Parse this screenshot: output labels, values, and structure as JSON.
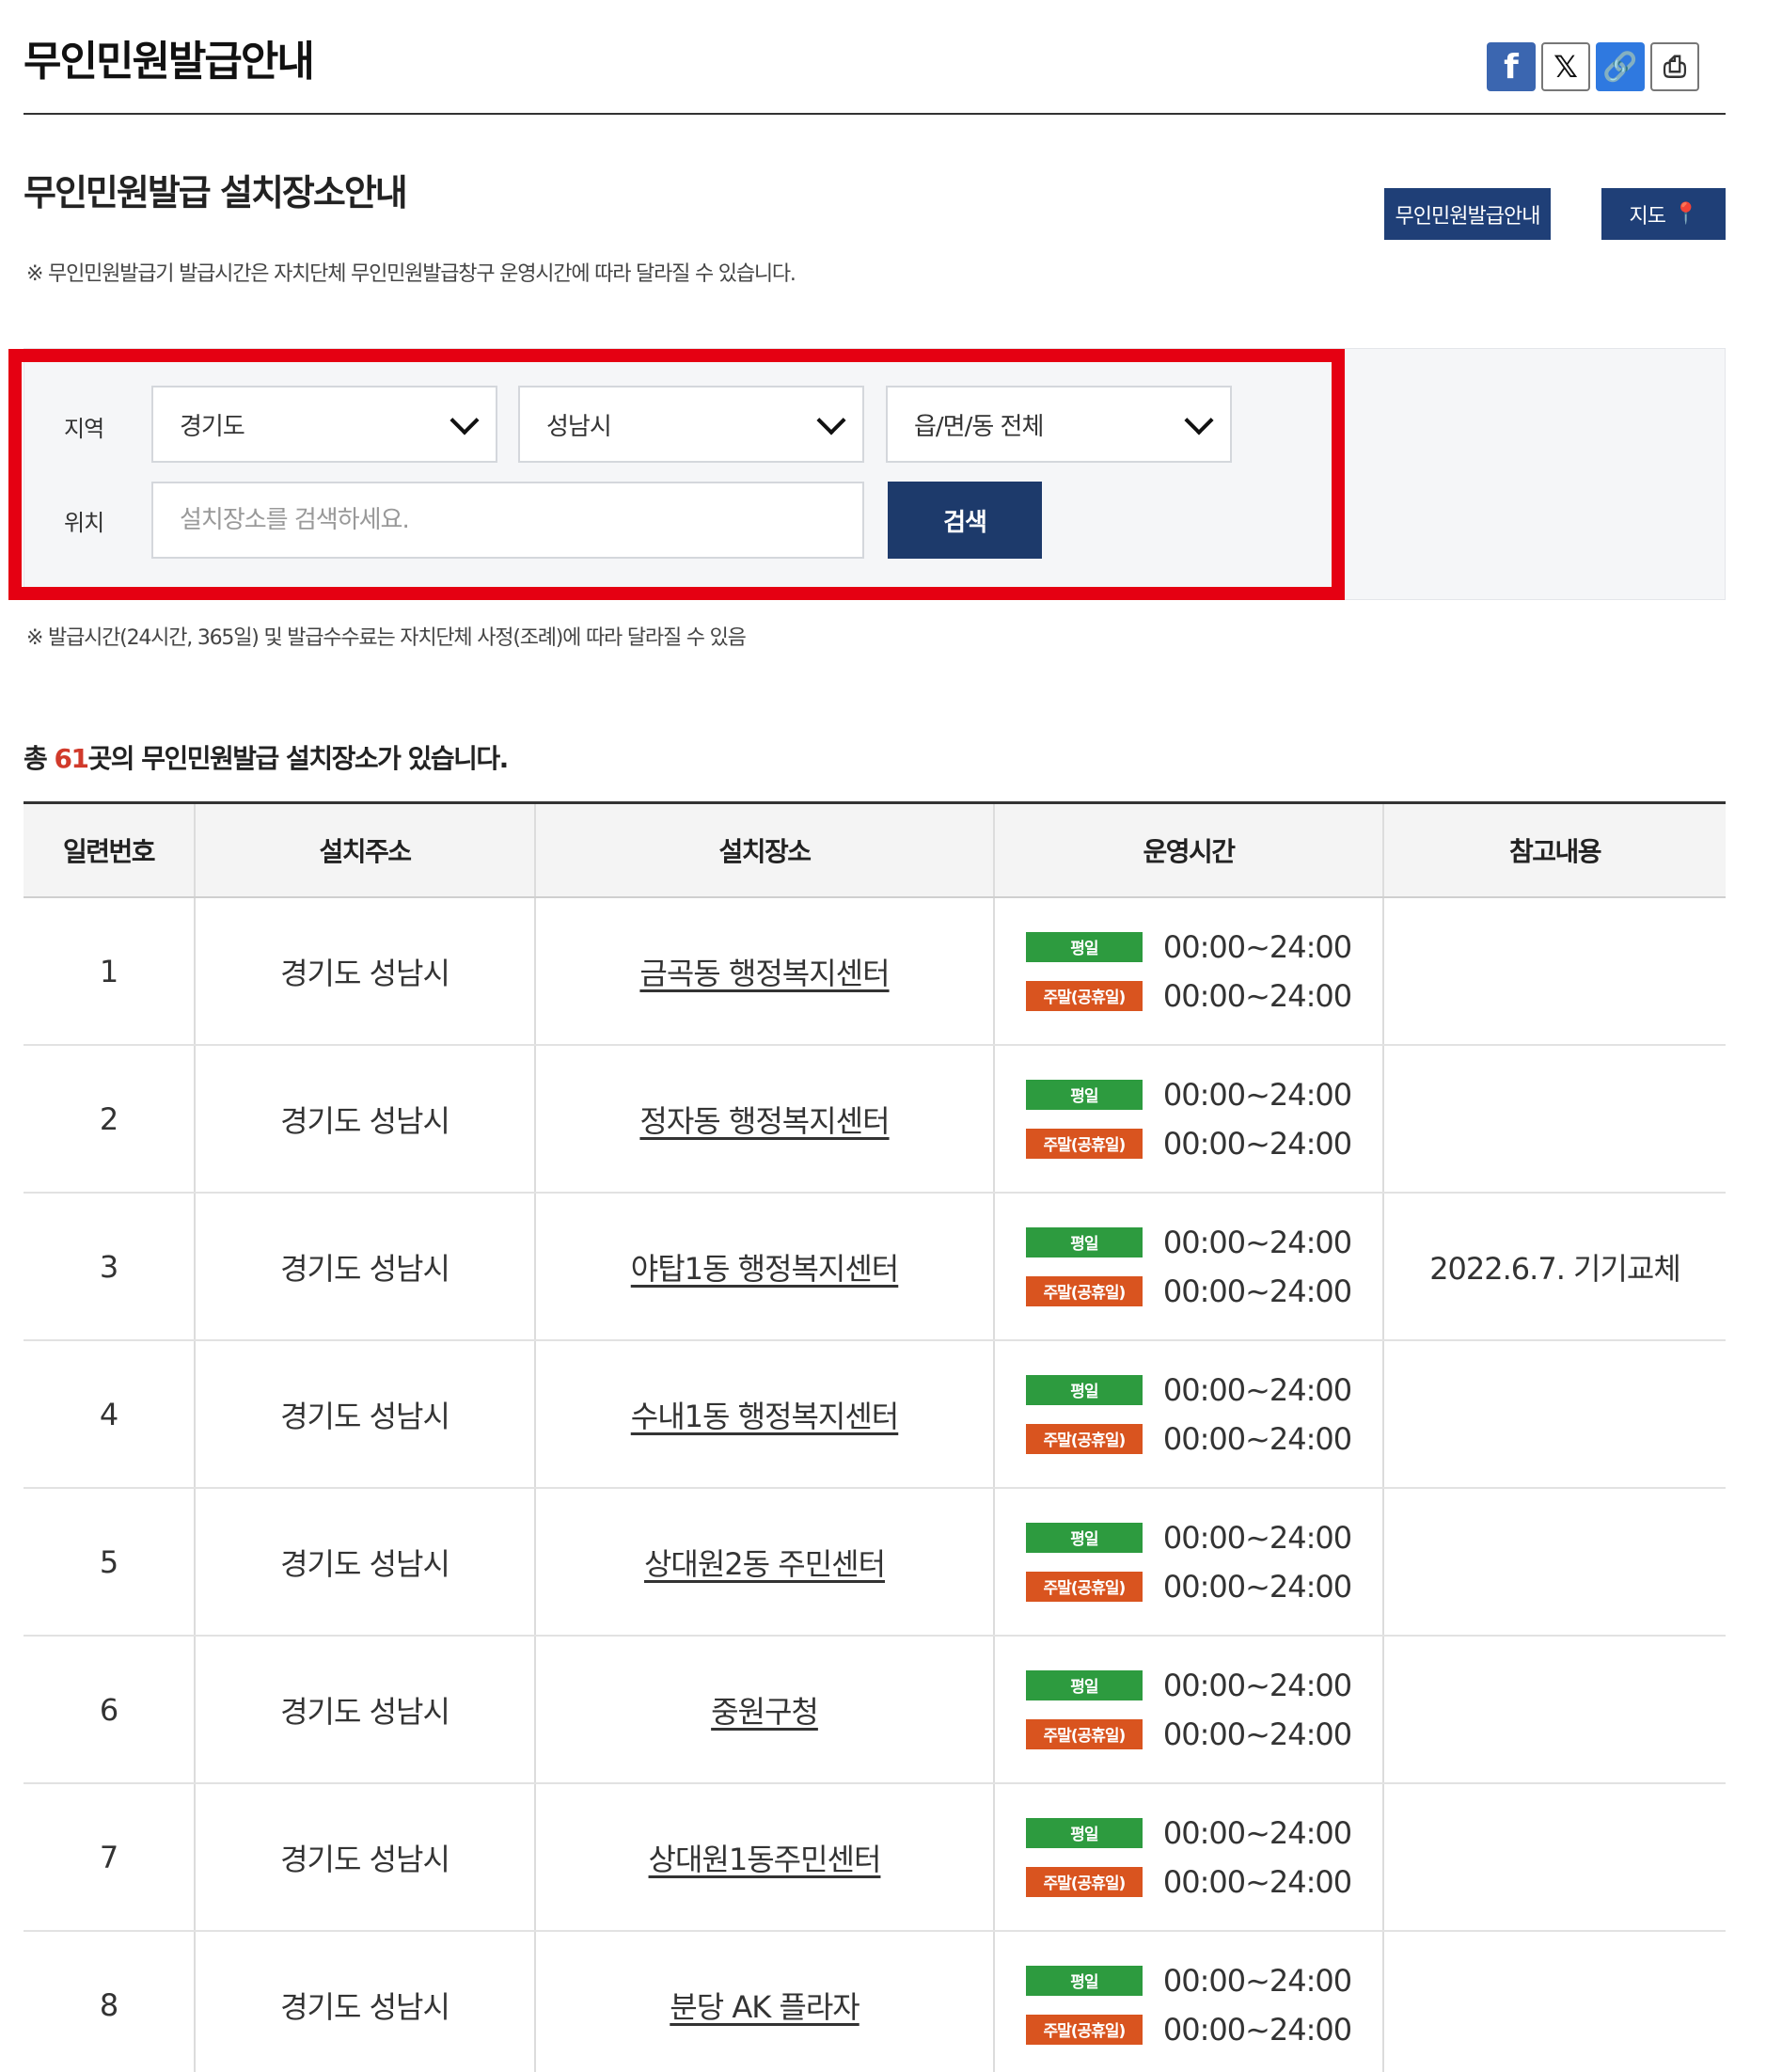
{
  "header": {
    "title": "무인민원발급안내",
    "share": {
      "facebook_icon": "facebook-icon",
      "x_icon": "x-icon",
      "link_icon": "link-icon",
      "print_icon": "print-icon"
    }
  },
  "section": {
    "title": "무인민원발급 설치장소안내",
    "guide_button": "무인민원발급안내",
    "map_button": "지도",
    "note_top": "※ 무인민원발급기 발급시간은 자치단체 무인민원발급창구 운영시간에 따라 달라질 수 있습니다."
  },
  "search": {
    "region_label": "지역",
    "location_label": "위치",
    "province": "경기도",
    "city": "성남시",
    "district": "읍/면/동 전체",
    "placeholder": "설치장소를 검색하세요.",
    "search_button": "검색",
    "note_bottom": "※ 발급시간(24시간, 365일) 및 발급수수료는 자치단체 사정(조례)에 따라 달라질 수 있음"
  },
  "summary": {
    "prefix": "총 ",
    "count": "61",
    "suffix": "곳의 무인민원발급 설치장소가 있습니다."
  },
  "table": {
    "headers": [
      "일련번호",
      "설치주소",
      "설치장소",
      "운영시간",
      "참고내용"
    ],
    "weekday_badge": "평일",
    "weekend_badge": "주말(공휴일)",
    "rows": [
      {
        "no": "1",
        "address": "경기도 성남시",
        "place": "금곡동 행정복지센터",
        "weekday": "00:00~24:00",
        "weekend": "00:00~24:00",
        "note": ""
      },
      {
        "no": "2",
        "address": "경기도 성남시",
        "place": "정자동 행정복지센터",
        "weekday": "00:00~24:00",
        "weekend": "00:00~24:00",
        "note": ""
      },
      {
        "no": "3",
        "address": "경기도 성남시",
        "place": "야탑1동 행정복지센터",
        "weekday": "00:00~24:00",
        "weekend": "00:00~24:00",
        "note": "2022.6.7. 기기교체"
      },
      {
        "no": "4",
        "address": "경기도 성남시",
        "place": "수내1동 행정복지센터",
        "weekday": "00:00~24:00",
        "weekend": "00:00~24:00",
        "note": ""
      },
      {
        "no": "5",
        "address": "경기도 성남시",
        "place": "상대원2동 주민센터",
        "weekday": "00:00~24:00",
        "weekend": "00:00~24:00",
        "note": ""
      },
      {
        "no": "6",
        "address": "경기도 성남시",
        "place": "중원구청",
        "weekday": "00:00~24:00",
        "weekend": "00:00~24:00",
        "note": ""
      },
      {
        "no": "7",
        "address": "경기도 성남시",
        "place": "상대원1동주민센터",
        "weekday": "00:00~24:00",
        "weekend": "00:00~24:00",
        "note": ""
      },
      {
        "no": "8",
        "address": "경기도 성남시",
        "place": "분당 AK 플라자",
        "weekday": "00:00~24:00",
        "weekend": "00:00~24:00",
        "note": ""
      }
    ]
  },
  "colors": {
    "highlight": "#e50012",
    "primary_button": "#1d3a6b",
    "weekday_badge": "#2d9b3f",
    "weekend_badge": "#d9541f",
    "count_text": "#d13a2b"
  }
}
